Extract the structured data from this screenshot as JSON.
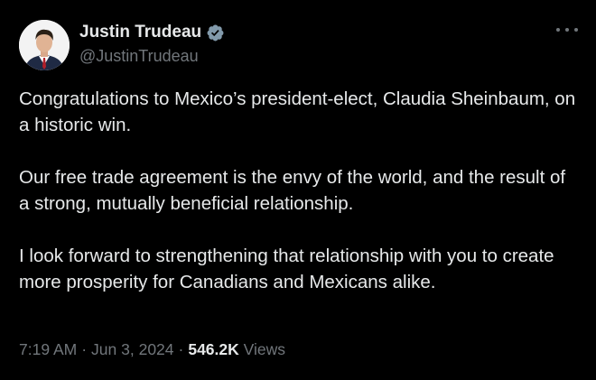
{
  "author": {
    "display_name": "Justin Trudeau",
    "handle": "@JustinTrudeau",
    "verified": true,
    "verified_icon": "verified-badge-icon",
    "avatar": "profile-photo"
  },
  "tweet": {
    "paragraphs": [
      "Congratulations to Mexico’s president-elect, Claudia Sheinbaum, on a historic win.",
      "Our free trade agreement is the envy of the world, and the result of a strong, mutually beneficial relationship.",
      "I look forward to strengthening that relationship with you to create more prosperity for Canadians and Mexicans alike."
    ]
  },
  "meta": {
    "time": "7:19 AM",
    "separator": "·",
    "date": "Jun 3, 2024",
    "views_count": "546.2K",
    "views_label": "Views"
  },
  "more_icon": "more-options-icon",
  "colors": {
    "background": "#000000",
    "primary_text": "#e7e9ea",
    "secondary_text": "#71767b",
    "verified": "#829aab"
  }
}
